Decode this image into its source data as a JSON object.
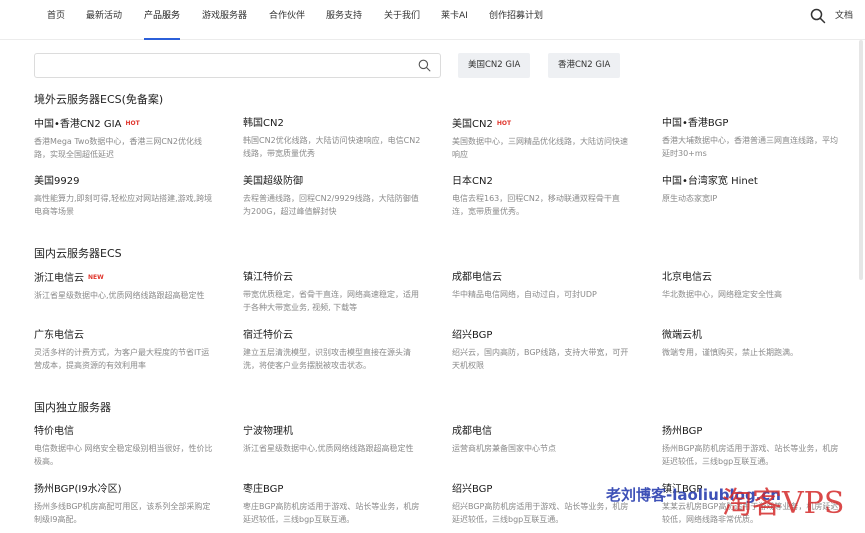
{
  "nav": {
    "items": [
      "首页",
      "最新活动",
      "产品服务",
      "游戏服务器",
      "合作伙伴",
      "服务支持",
      "关于我们",
      "莱卡AI",
      "创作招募计划"
    ],
    "active_index": 2,
    "lang": "文档"
  },
  "search": {
    "placeholder": "",
    "filters": [
      "美国CN2 GIA",
      "香港CN2 GIA"
    ]
  },
  "sections": [
    {
      "title": "境外云服务器ECS(免备案)",
      "items": [
        {
          "name": "中国•香港CN2 GIA",
          "badge": "HOT",
          "desc": "香港Mega Two数据中心，香港三网CN2优化线路，实现全国超低延迟"
        },
        {
          "name": "韩国CN2",
          "badge": "",
          "desc": "韩国CN2优化线路，大陆访问快速响应，电信CN2线路，带宽质量优秀"
        },
        {
          "name": "美国CN2",
          "badge": "HOT",
          "desc": "美国数据中心，三网精品优化线路，大陆访问快速响应"
        },
        {
          "name": "中国•香港BGP",
          "badge": "",
          "desc": "香港大埔数据中心，香港普通三网直连线路，平均延时30+ms"
        },
        {
          "name": "美国9929",
          "badge": "",
          "desc": "高性能算力,即刻可得,轻松应对网站搭建,游戏,跨境电商等场景"
        },
        {
          "name": "美国超级防御",
          "badge": "",
          "desc": "去程普通线路，回程CN2/9929线路，大陆防御值为200G，超过峰值解封快"
        },
        {
          "name": "日本CN2",
          "badge": "",
          "desc": "电信去程163，回程CN2，移动联通双程骨干直连，宽带质量优秀。"
        },
        {
          "name": "中国•台湾家宽 Hinet",
          "badge": "",
          "desc": "原生动态家宽IP"
        }
      ]
    },
    {
      "title": "国内云服务器ECS",
      "items": [
        {
          "name": "浙江电信云",
          "badge": "NEW",
          "desc": "浙江省星级数据中心,优质网络线路跟超高稳定性"
        },
        {
          "name": "镇江特价云",
          "badge": "",
          "desc": "带宽优质稳定，省骨干直连，网络高速稳定，适用于各种大带宽业务, 视频, 下载等"
        },
        {
          "name": "成都电信云",
          "badge": "",
          "desc": "华中精品电信网络，自动过白，可封UDP"
        },
        {
          "name": "北京电信云",
          "badge": "",
          "desc": "华北数据中心，网络稳定安全性高"
        },
        {
          "name": "广东电信云",
          "badge": "",
          "desc": "灵活多样的计费方式，为客户最大程度的节省IT运营成本，提高资源的有效利用率"
        },
        {
          "name": "宿迁特价云",
          "badge": "",
          "desc": "建立五层清洗模型，识别攻击模型直接在源头清洗，将使客户业务摆脱被攻击状态。"
        },
        {
          "name": "绍兴BGP",
          "badge": "",
          "desc": "绍兴云，国内高防，BGP线路，支持大带宽，可开天机权限"
        },
        {
          "name": "微端云机",
          "badge": "",
          "desc": "微端专用，谨慎购买，禁止长期跑满。"
        }
      ]
    },
    {
      "title": "国内独立服务器",
      "items": [
        {
          "name": "特价电信",
          "badge": "",
          "desc": "电信数据中心 网络安全稳定级别相当很好，性价比极高。"
        },
        {
          "name": "宁波物理机",
          "badge": "",
          "desc": "浙江省星级数据中心,优质网络线路跟超高稳定性"
        },
        {
          "name": "成都电信",
          "badge": "",
          "desc": "运营商机房兼备国家中心节点"
        },
        {
          "name": "扬州BGP",
          "badge": "",
          "desc": "扬州BGP高防机房适用于游戏、站长等业务，机房延迟较低，三线bgp互联互通。"
        },
        {
          "name": "扬州BGP(I9水冷区)",
          "badge": "",
          "desc": "扬州多线BGP机房高配可用区，该系列全部采购定制级I9高配。"
        },
        {
          "name": "枣庄BGP",
          "badge": "",
          "desc": "枣庄BGP高防机房适用于游戏、站长等业务，机房延迟较低，三线bgp互联互通。"
        },
        {
          "name": "绍兴BGP",
          "badge": "",
          "desc": "绍兴BGP高防机房适用于游戏、站长等业务，机房延迟较低，三线bgp互联互通。"
        },
        {
          "name": "镇江BGP",
          "badge": "",
          "desc": "某某云机房BGP高防适用于游戏等业务，机房延迟较低，网络线路非常优质。"
        }
      ]
    }
  ],
  "watermark": {
    "text1": "老刘博客-laoliublog.cn",
    "text2": "淘客VPS"
  }
}
